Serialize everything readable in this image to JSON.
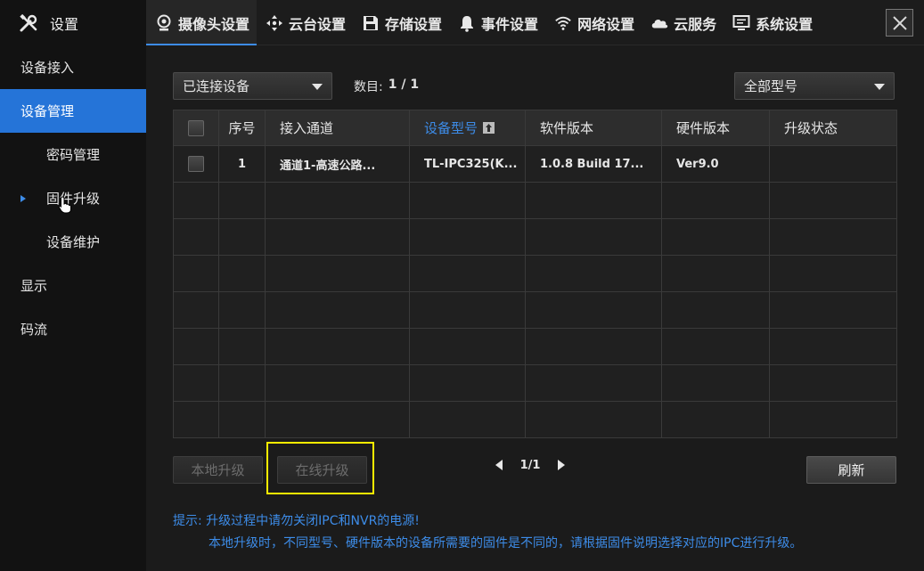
{
  "app": {
    "title": "设置",
    "icon": "tools-icon"
  },
  "tabs": [
    {
      "label": "摄像头设置",
      "icon": "camera-icon",
      "active": true
    },
    {
      "label": "云台设置",
      "icon": "ptz-arrows-icon",
      "active": false
    },
    {
      "label": "存储设置",
      "icon": "floppy-disk-icon",
      "active": false
    },
    {
      "label": "事件设置",
      "icon": "bell-icon",
      "active": false
    },
    {
      "label": "网络设置",
      "icon": "wifi-icon",
      "active": false
    },
    {
      "label": "云服务",
      "icon": "cloud-icon",
      "active": false
    },
    {
      "label": "系统设置",
      "icon": "monitor-icon",
      "active": false
    }
  ],
  "sidebar": {
    "items": [
      {
        "label": "设备接入",
        "sub": false,
        "active": false
      },
      {
        "label": "设备管理",
        "sub": false,
        "active": true
      },
      {
        "label": "密码管理",
        "sub": true,
        "active": false
      },
      {
        "label": "固件升级",
        "sub": true,
        "active": false,
        "current": true
      },
      {
        "label": "设备维护",
        "sub": true,
        "active": false
      },
      {
        "label": "显示",
        "sub": false,
        "active": false
      },
      {
        "label": "码流",
        "sub": false,
        "active": false
      }
    ]
  },
  "filters": {
    "device_filter": "已连接设备",
    "count_label": "数目:",
    "count_value": "1 / 1",
    "model_filter": "全部型号"
  },
  "table": {
    "headers": [
      "序号",
      "接入通道",
      "设备型号",
      "软件版本",
      "硬件版本",
      "升级状态"
    ],
    "sorted_column": "设备型号",
    "rows": [
      {
        "index": "1",
        "channel": "通道1-高速公路...",
        "model": "TL-IPC325(K...",
        "software": "1.0.8 Build 17...",
        "hardware": "Ver9.0",
        "status": ""
      }
    ],
    "empty_rows": 7
  },
  "actions": {
    "local_upgrade": "本地升级",
    "online_upgrade": "在线升级",
    "refresh": "刷新"
  },
  "pager": {
    "page": "1/1"
  },
  "tip": {
    "line1": "提示: 升级过程中请勿关闭IPC和NVR的电源!",
    "line2": "本地升级时，不同型号、硬件版本的设备所需要的固件是不同的，请根据固件说明选择对应的IPC进行升级。"
  },
  "colors": {
    "accent": "#3d8ce8",
    "highlight": "#ffec00",
    "sidebar_active": "#2574d8"
  }
}
